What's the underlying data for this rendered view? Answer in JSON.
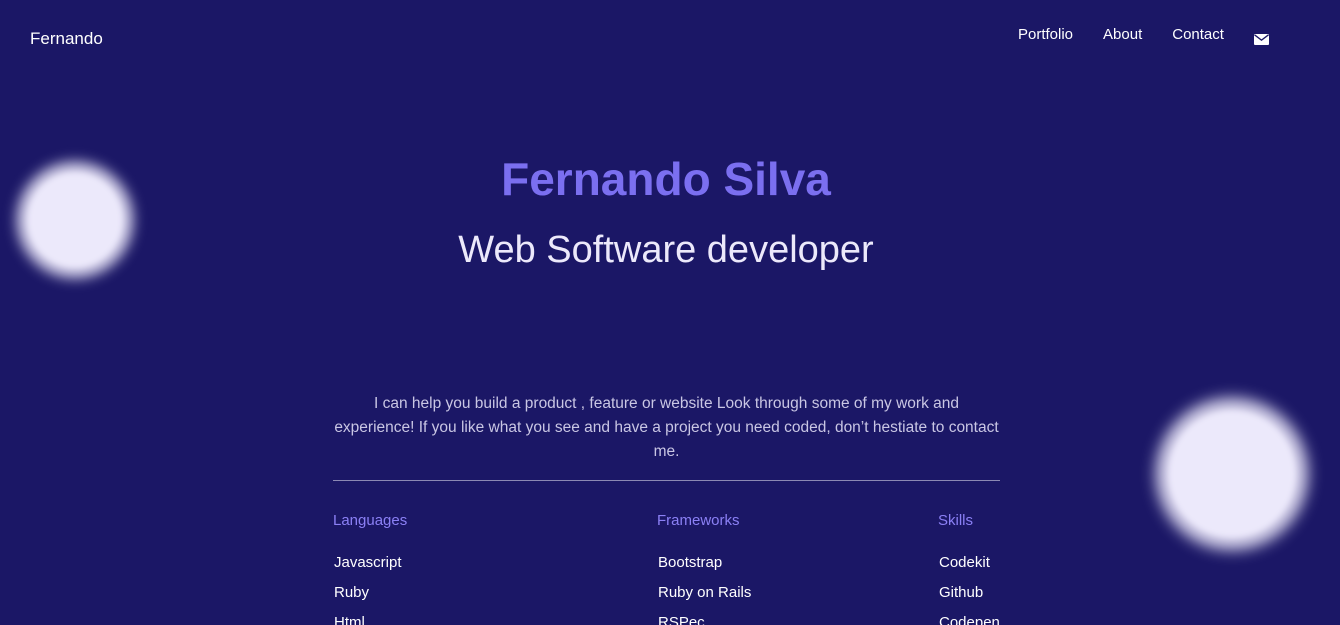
{
  "header": {
    "brand": "Fernando",
    "nav": {
      "portfolio": "Portfolio",
      "about": "About",
      "contact": "Contact",
      "mail_icon": "envelope-icon"
    }
  },
  "hero": {
    "name": "Fernando Silva",
    "role": "Web Software developer",
    "intro": "I can help you build a product , feature or website Look through some of my work and experience! If you like what you see and have a project you need coded, don’t hestiate to contact me."
  },
  "columns": {
    "languages": {
      "title": "Languages",
      "items": [
        "Javascript",
        "Ruby",
        "Html"
      ]
    },
    "frameworks": {
      "title": "Frameworks",
      "items": [
        "Bootstrap",
        "Ruby on Rails",
        "RSPec"
      ]
    },
    "skills": {
      "title": "Skills",
      "items": [
        "Codekit",
        "Github",
        "Codepen"
      ]
    }
  },
  "colors": {
    "background": "#1b1766",
    "accent": "#7b6ff0",
    "heading_accent": "#8b80f5",
    "orb": "#ece9fb"
  }
}
